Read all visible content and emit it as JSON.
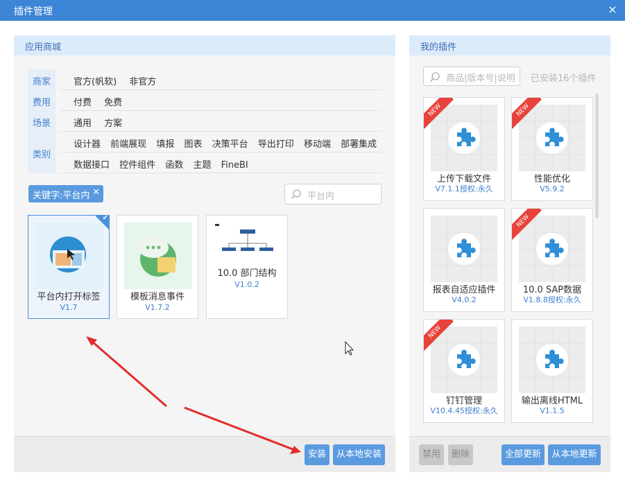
{
  "window": {
    "title": "插件管理",
    "close_icon": "×"
  },
  "store": {
    "title": "应用商城",
    "categories": [
      {
        "label": "商家",
        "options": [
          "官方(帆软)",
          "非官方"
        ]
      },
      {
        "label": "费用",
        "options": [
          "付费",
          "免费"
        ]
      },
      {
        "label": "场景",
        "options": [
          "通用",
          "方案"
        ]
      },
      {
        "label": "类别",
        "options": [
          "设计器",
          "前端展现",
          "填报",
          "图表",
          "决策平台",
          "导出打印",
          "移动端",
          "部署集成"
        ],
        "options2": [
          "数据接口",
          "控件组件",
          "函数",
          "主题",
          "FineBI"
        ]
      }
    ],
    "keyword_tag": "关键字:平台内",
    "search_placeholder": "平台内",
    "cards": [
      {
        "name": "平台内打开标签",
        "version": "V1.7",
        "selected": true
      },
      {
        "name": "模板消息事件",
        "version": "V1.7.2",
        "selected": false
      },
      {
        "name": "10.0 部门结构",
        "version": "V1.0.2",
        "selected": false
      }
    ],
    "install_label": "安装",
    "local_install_label": "从本地安装"
  },
  "mine": {
    "title": "我的插件",
    "search_placeholder": "商品|版本号|说明",
    "installed_text": "已安装16个插件",
    "new_badge": "NEW",
    "cards": [
      {
        "name": "上传下载文件",
        "version": "V7.1.1授权:永久",
        "new": true
      },
      {
        "name": "性能优化",
        "version": "V5.9.2",
        "new": true
      },
      {
        "name": "报表自适应插件",
        "version": "V4.0.2",
        "new": false
      },
      {
        "name": "10.0 SAP数据",
        "version": "V1.8.8授权:永久",
        "new": true
      },
      {
        "name": "钉钉管理",
        "version": "V10.4.45授权:永久",
        "new": true
      },
      {
        "name": "输出离线HTML",
        "version": "V1.1.5",
        "new": false
      }
    ],
    "disable_label": "禁用",
    "delete_label": "删除",
    "update_all_label": "全部更新",
    "local_update_label": "从本地更新"
  },
  "colors": {
    "accent": "#3d85d6",
    "ribbon": "#e8433a",
    "annotation": "#e22b2b"
  }
}
